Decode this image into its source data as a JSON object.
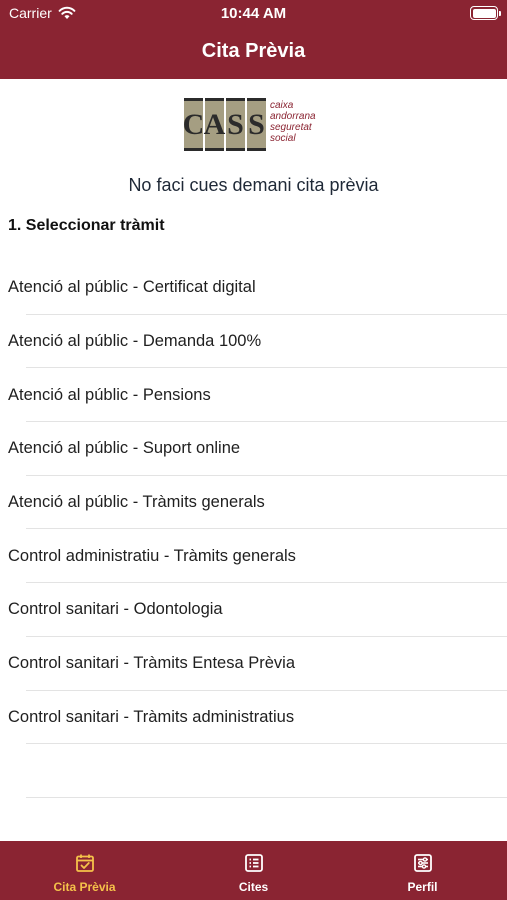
{
  "status_bar": {
    "carrier": "Carrier",
    "time": "10:44 AM"
  },
  "nav": {
    "title": "Cita Prèvia"
  },
  "logo": {
    "letters": [
      "C",
      "A",
      "S",
      "S"
    ],
    "text_lines": [
      "caixa",
      "andorrana",
      "seguretat",
      "social"
    ]
  },
  "headline": "No faci cues demani cita prèvia",
  "section_title": "1. Seleccionar tràmit",
  "procedures": [
    "Atenció al públic - Certificat digital",
    "Atenció al públic - Demanda 100%",
    "Atenció al públic - Pensions",
    "Atenció al públic - Suport online",
    "Atenció al públic - Tràmits generals",
    "Control administratiu - Tràmits generals",
    "Control sanitari - Odontologia",
    "Control sanitari - Tràmits Entesa Prèvia",
    "Control sanitari - Tràmits administratius"
  ],
  "tabs": [
    {
      "label": "Cita Prèvia",
      "icon": "calendar-check-icon",
      "active": true
    },
    {
      "label": "Cites",
      "icon": "list-icon",
      "active": false
    },
    {
      "label": "Perfil",
      "icon": "sliders-icon",
      "active": false
    }
  ],
  "colors": {
    "brand": "#8a2432",
    "active_tab": "#f5c24a"
  }
}
